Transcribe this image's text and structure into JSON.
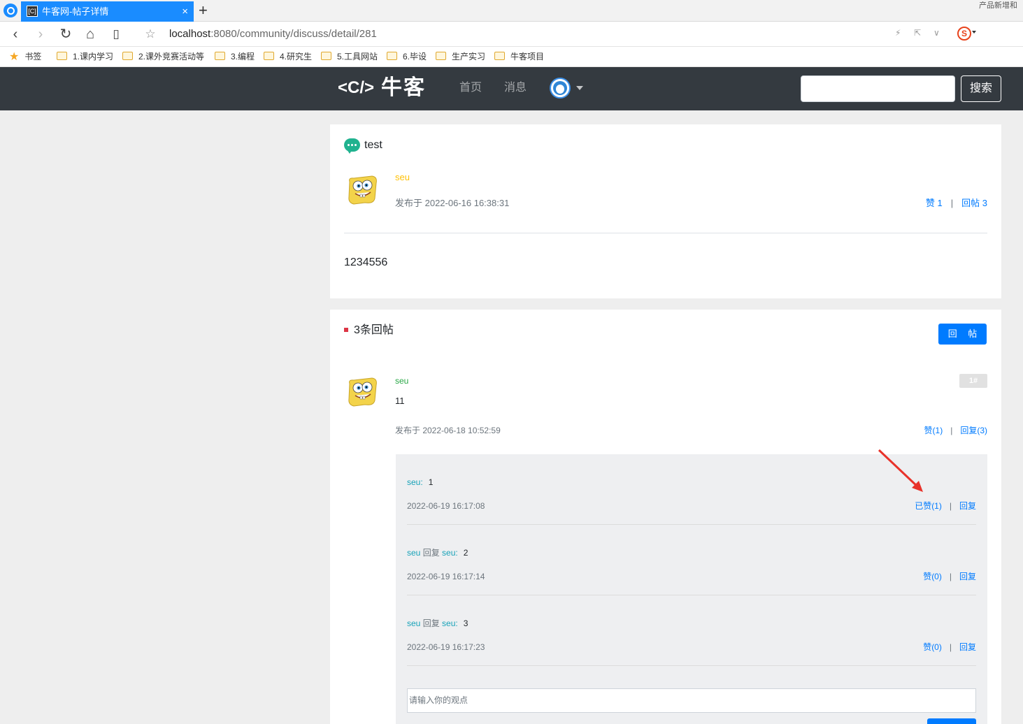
{
  "browser": {
    "tab_title": "牛客网-帖子详情",
    "tab_favicon": "[C]",
    "close_glyph": "×",
    "new_tab_glyph": "+",
    "top_right_text": "产品新增和",
    "url_host": "localhost",
    "url_rest": ":8080/community/discuss/detail/281",
    "bookmarks": [
      "书签",
      "1.课内学习",
      "2.课外竞赛活动等",
      "3.编程",
      "4.研究生",
      "5.工具网站",
      "6.毕设",
      "生产实习",
      "牛客项目"
    ]
  },
  "header": {
    "logo_mark": "<C/>",
    "logo_text": "牛客",
    "nav": [
      "首页",
      "消息"
    ],
    "search_button": "搜索"
  },
  "post": {
    "title": "test",
    "author": "seu",
    "time": "发布于 2022-06-16 16:38:31",
    "like_label": "赞 1",
    "reply_label": "回帖 3",
    "separator": "|",
    "content": "1234556"
  },
  "comments": {
    "title": "3条回帖",
    "reply_button": "回 帖",
    "list": [
      {
        "author": "seu",
        "floor": "1#",
        "text": "11",
        "time": "发布于 2022-06-18 10:52:59",
        "like_label": "赞(1)",
        "reply_label": "回复(3)",
        "replies": [
          {
            "author": "seu:",
            "target_prefix": "",
            "target": "",
            "text": "1",
            "time": "2022-06-19 16:17:08",
            "like_label": "已赞(1)",
            "reply_label": "回复"
          },
          {
            "author": "seu",
            "target_prefix": " 回复 ",
            "target": "seu:",
            "text": "2",
            "time": "2022-06-19 16:17:14",
            "like_label": "赞(0)",
            "reply_label": "回复"
          },
          {
            "author": "seu",
            "target_prefix": " 回复 ",
            "target": "seu:",
            "text": "3",
            "time": "2022-06-19 16:17:23",
            "like_label": "赞(0)",
            "reply_label": "回复"
          }
        ],
        "input_placeholder": "请输入你的观点"
      }
    ]
  },
  "colors": {
    "accent": "#007bff",
    "header_bg": "#343a40",
    "author_post": "#ffc107",
    "author_comment": "#28a745",
    "arrow": "#e8322a"
  }
}
